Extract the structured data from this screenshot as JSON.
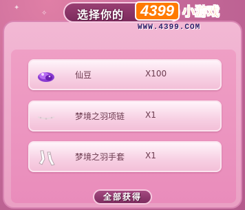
{
  "dialog": {
    "title": "选择你的",
    "claim_all_label": "全部获得"
  },
  "brand": {
    "number": "4399",
    "game": "小游戏",
    "url": "WWW.4399.COM"
  },
  "rewards": [
    {
      "name": "仙豆",
      "quantity": "X100",
      "icon": "gem-icon"
    },
    {
      "name": "梦境之羽项链",
      "quantity": "X1",
      "icon": "necklace-icon"
    },
    {
      "name": "梦境之羽手套",
      "quantity": "X1",
      "icon": "gloves-icon"
    }
  ],
  "colors": {
    "panel": "#f2b8d4",
    "title_tab": "#7b2a5c",
    "brand_orange": "#ff7a00",
    "item_text": "#6b3a4e"
  }
}
